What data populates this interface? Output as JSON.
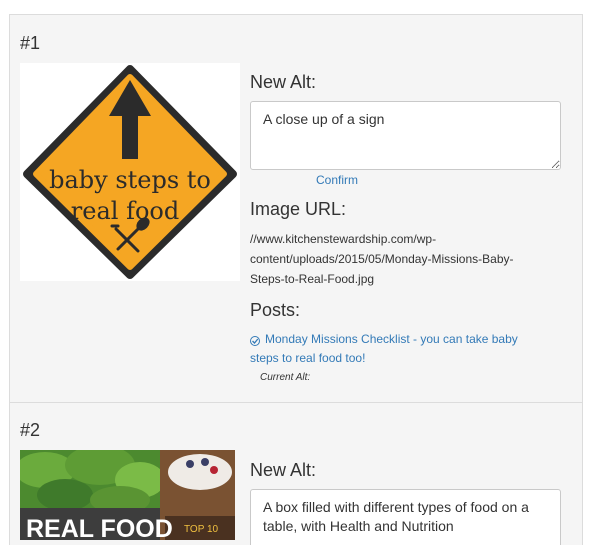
{
  "items": [
    {
      "number": "#1",
      "image_alt_description": "baby steps to real food",
      "sign_line1": "baby steps to",
      "sign_line2": "real food",
      "new_alt_label": "New Alt:",
      "new_alt_value": "A close up of a sign",
      "confirm_label": "Confirm",
      "image_url_label": "Image URL:",
      "image_url_lines": [
        "//www.kitchenstewardship.com/wp-",
        "content/uploads/2015/05/Monday-Missions-Baby-",
        "Steps-to-Real-Food.jpg"
      ],
      "posts_label": "Posts:",
      "post_link_lines": [
        "Monday Missions Checklist - you can take baby",
        "steps to real food too!"
      ],
      "current_alt_label": "Current Alt:"
    },
    {
      "number": "#2",
      "banner_text": "REAL FOOD",
      "badge_text": "TOP 10",
      "new_alt_label": "New Alt:",
      "new_alt_value": "A box filled with different types of food on a table, with Health and Nutrition"
    }
  ],
  "colors": {
    "panel_bg": "#f5f5f5",
    "link": "#337ab7",
    "sign_orange": "#f5a623",
    "sign_border": "#2b2b2b"
  }
}
